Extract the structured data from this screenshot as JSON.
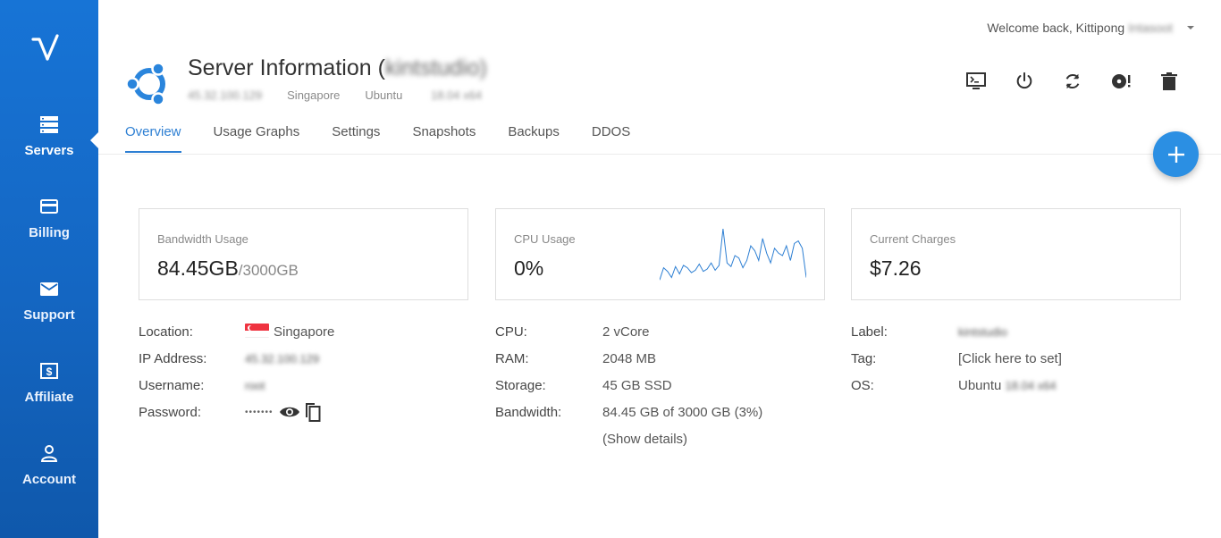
{
  "sidebar": {
    "items": [
      {
        "label": "Servers",
        "icon": "servers-icon",
        "active": true
      },
      {
        "label": "Billing",
        "icon": "credit-card-icon"
      },
      {
        "label": "Support",
        "icon": "mail-icon"
      },
      {
        "label": "Affiliate",
        "icon": "dollar-icon"
      },
      {
        "label": "Account",
        "icon": "user-icon"
      }
    ]
  },
  "header": {
    "welcome": "Welcome back, Kittipong",
    "welcome_blurred": "Intasoot",
    "title": "Server Information (",
    "title_blurred": "kintstudio)",
    "ip": "45.32.100.129",
    "region": "Singapore",
    "os_short": "Ubuntu",
    "os_blurred": "18.04 x64",
    "actions": [
      "console-icon",
      "power-icon",
      "restart-icon",
      "reinstall-icon",
      "delete-icon"
    ]
  },
  "tabs": [
    "Overview",
    "Usage Graphs",
    "Settings",
    "Snapshots",
    "Backups",
    "DDOS"
  ],
  "active_tab": "Overview",
  "cards": {
    "bandwidth": {
      "label": "Bandwidth Usage",
      "value": "84.45GB",
      "sub": "/3000GB"
    },
    "cpu": {
      "label": "CPU Usage",
      "value": "0%",
      "sparkline": [
        2,
        12,
        9,
        4,
        13,
        7,
        14,
        12,
        8,
        10,
        15,
        9,
        11,
        16,
        10,
        14,
        44,
        16,
        13,
        22,
        20,
        12,
        18,
        30,
        26,
        18,
        36,
        24,
        16,
        28,
        24,
        22,
        30,
        18,
        32,
        34,
        28,
        4
      ]
    },
    "charges": {
      "label": "Current Charges",
      "value": "$7.26"
    }
  },
  "details_left": [
    {
      "label": "Location:",
      "value": "Singapore"
    },
    {
      "label": "IP Address:",
      "value": "45.32.100.129"
    },
    {
      "label": "Username:",
      "value": "root"
    },
    {
      "label": "Password:",
      "value": "•••••••"
    }
  ],
  "details_mid": [
    {
      "label": "CPU:",
      "value": "2 vCore"
    },
    {
      "label": "RAM:",
      "value": "2048 MB"
    },
    {
      "label": "Storage:",
      "value": "45 GB SSD"
    },
    {
      "label": "Bandwidth:",
      "value": "84.45 GB of 3000 GB (3%)"
    },
    {
      "label": "",
      "value": "(Show details)"
    }
  ],
  "details_right": [
    {
      "label": "Label:",
      "value": "kintstudio"
    },
    {
      "label": "Tag:",
      "value": "[Click here to set]"
    },
    {
      "label": "OS:",
      "value": "Ubuntu",
      "value_blurred": "18.04 x64"
    }
  ],
  "colors": {
    "accent": "#2d7fd3",
    "sidebar": "#1466c2",
    "fab": "#2b8fe3",
    "os_logo": "#2a85dc"
  }
}
